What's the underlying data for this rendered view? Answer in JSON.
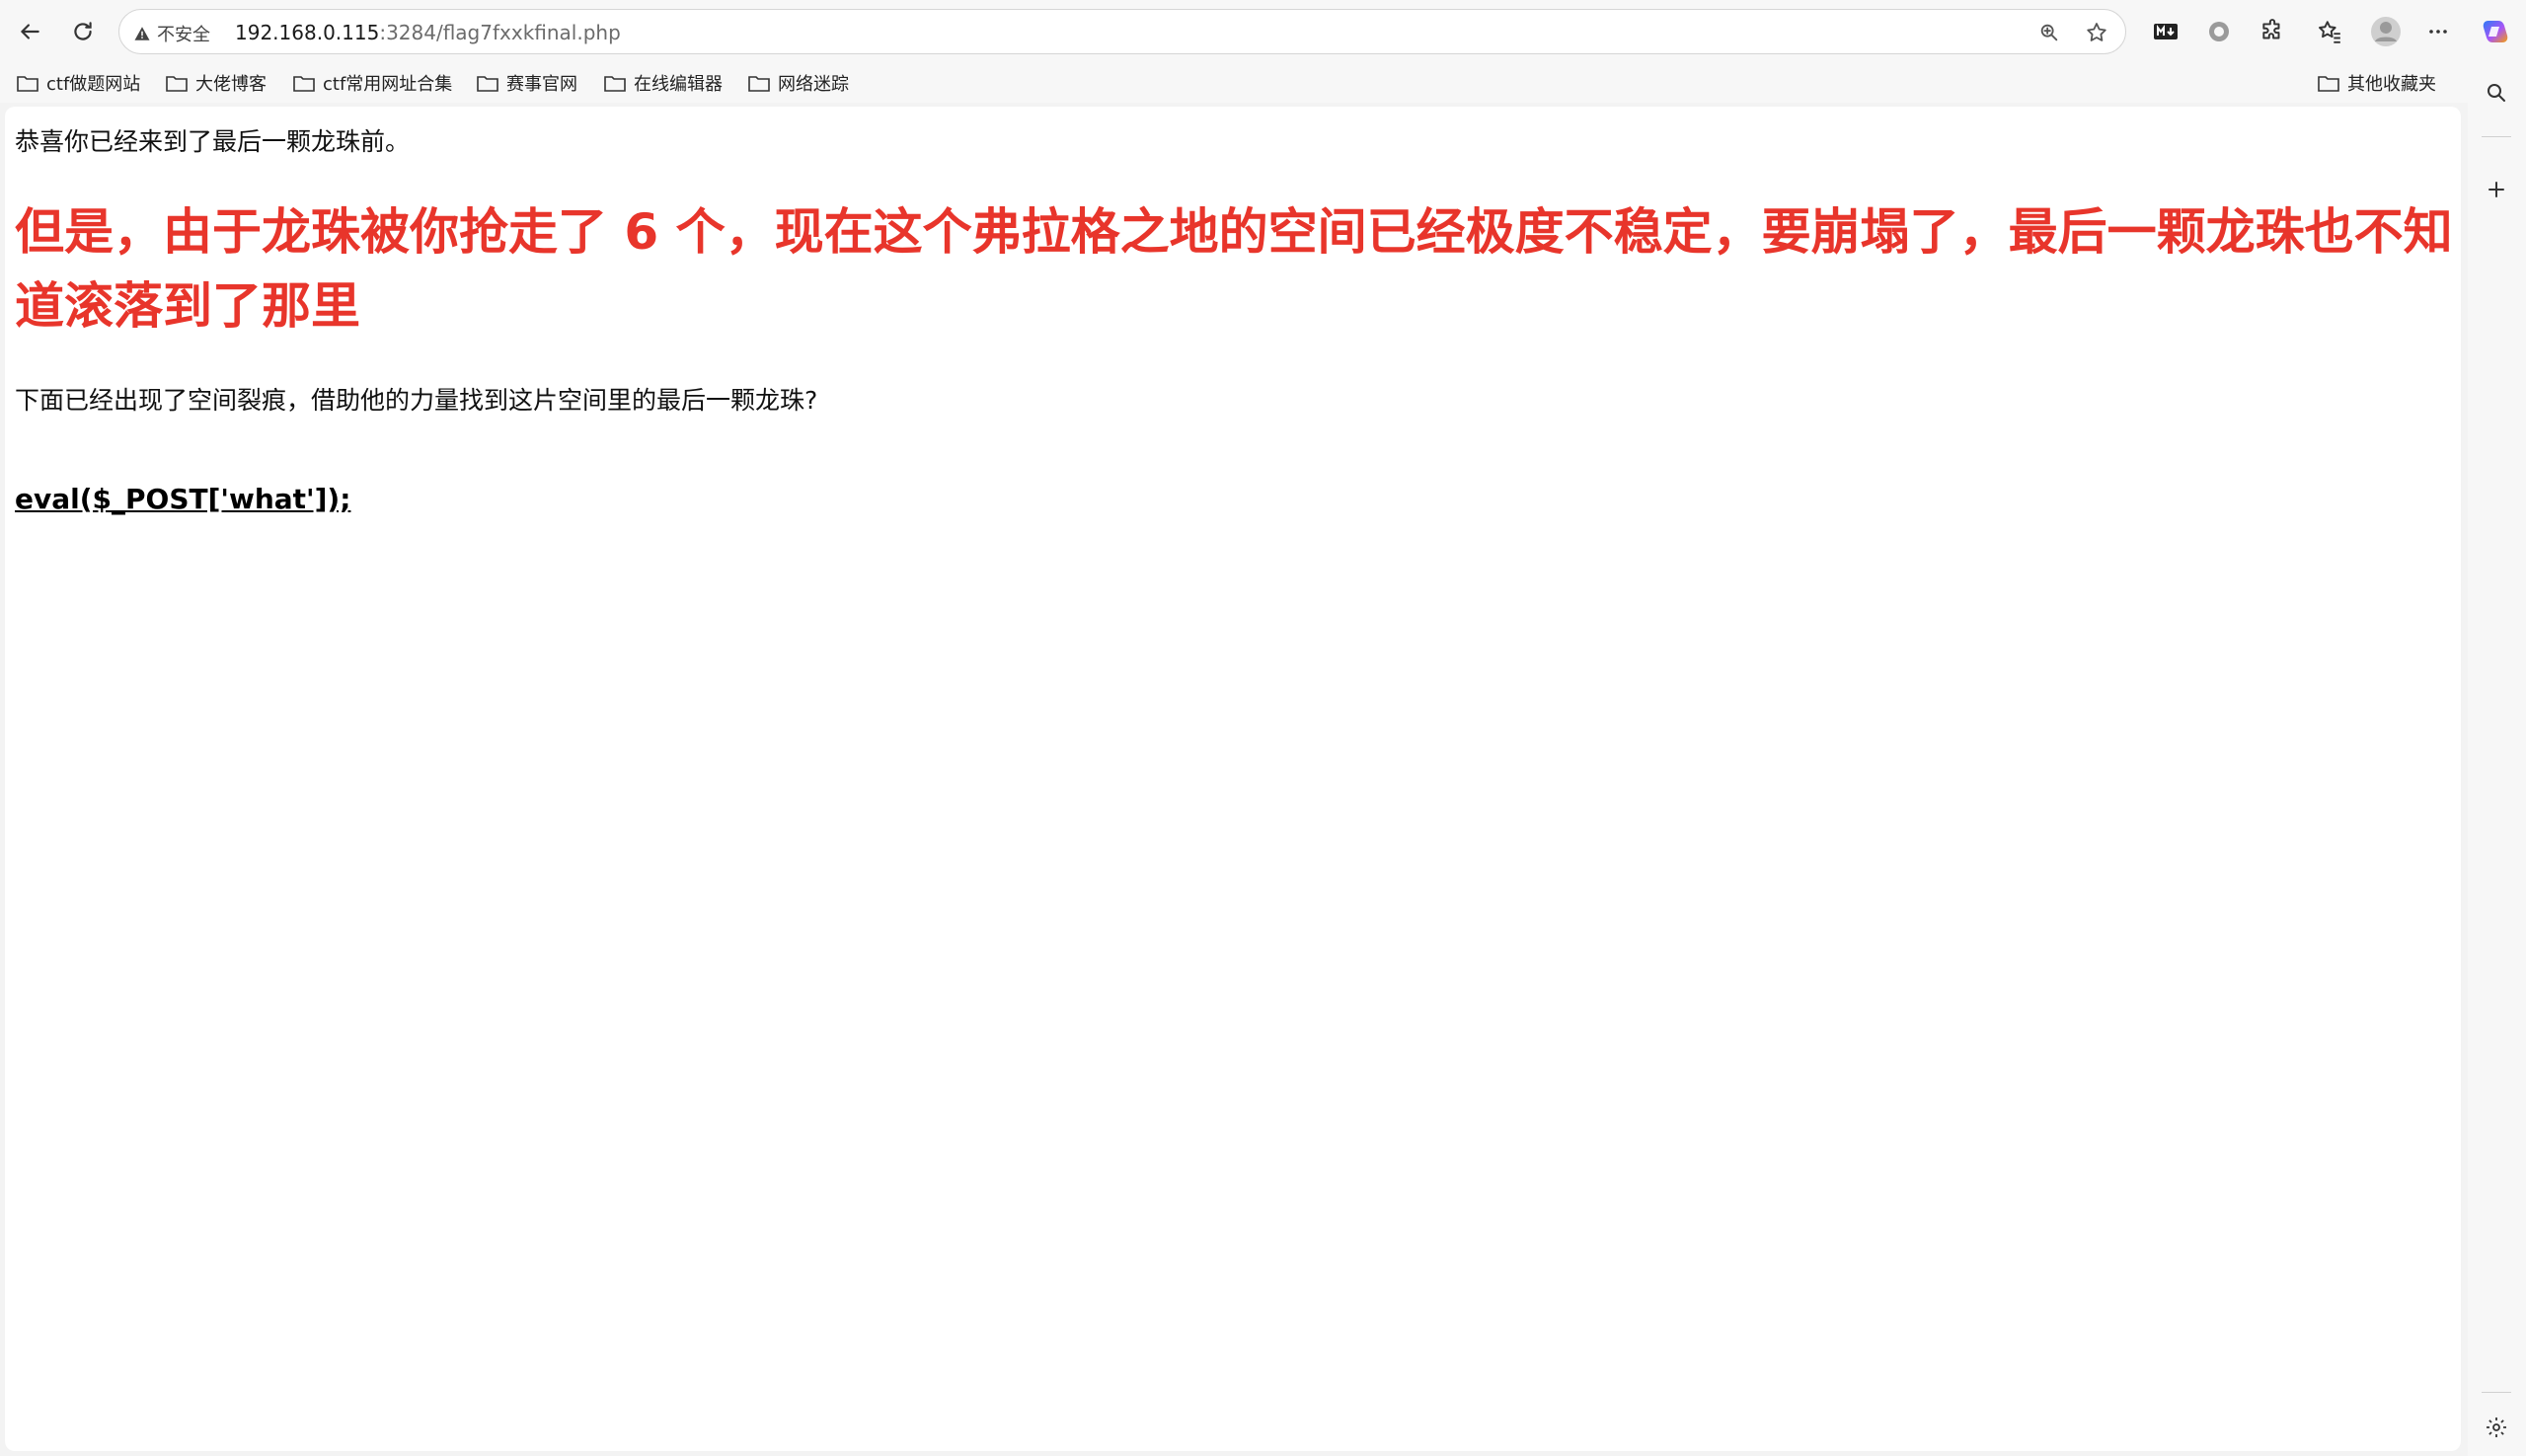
{
  "browser": {
    "address_bar": {
      "security_label": "不安全",
      "url_host": "192.168.0.115",
      "url_path": ":3284/flag7fxxkfinal.php"
    },
    "bookmarks": [
      {
        "label": "ctf做题网站"
      },
      {
        "label": "大佬博客"
      },
      {
        "label": "ctf常用网址合集"
      },
      {
        "label": "赛事官网"
      },
      {
        "label": "在线编辑器"
      },
      {
        "label": "网络迷踪"
      }
    ],
    "other_bookmarks": "其他收藏夹",
    "icons": {
      "back": "back-arrow-icon",
      "refresh": "refresh-icon",
      "zoom": "zoom-icon",
      "favorite": "star-icon",
      "markdown": "markdown-extension-icon",
      "extension_circle": "circle-extension-icon",
      "extensions": "puzzle-icon",
      "favorites": "favorites-icon",
      "profile": "profile-avatar-icon",
      "more": "more-icon",
      "copilot": "copilot-icon",
      "sidebar_search": "search-icon",
      "sidebar_add": "plus-icon",
      "sidebar_settings": "gear-icon"
    }
  },
  "content": {
    "intro": "恭喜你已经来到了最后一颗龙珠前。",
    "headline": "但是，由于龙珠被你抢走了 6 个，现在这个弗拉格之地的空间已经极度不稳定，要崩塌了，最后一颗龙珠也不知道滚落到了那里",
    "hint": "下面已经出现了空间裂痕，借助他的力量找到这片空间里的最后一颗龙珠?",
    "code": "eval($_POST['what']);"
  },
  "colors": {
    "headline": "#e8352b",
    "copilot_gradient": [
      "#2b7bf6",
      "#a855f7",
      "#f59e0b"
    ]
  }
}
